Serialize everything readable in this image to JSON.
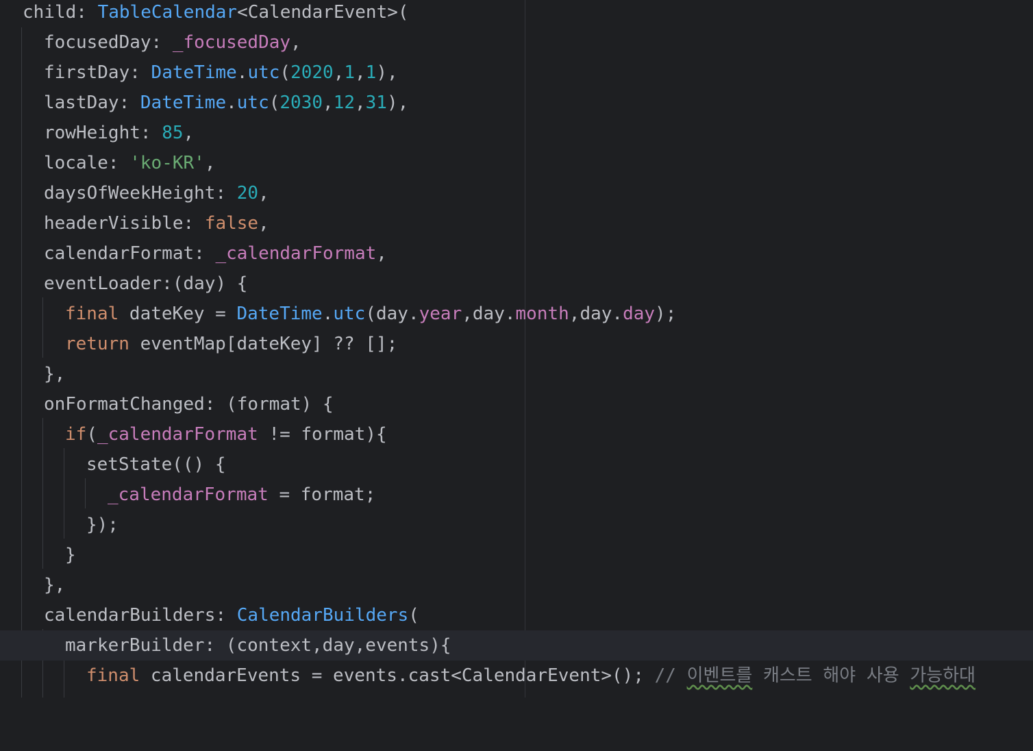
{
  "editor": {
    "lines": [
      [
        "child: ",
        "TableCalendar",
        "<CalendarEvent>("
      ],
      [
        "focusedDay: ",
        "_focusedDay",
        ","
      ],
      [
        "firstDay: ",
        "DateTime",
        ".",
        "utc",
        "(",
        "2020",
        ",",
        "1",
        ",",
        "1",
        "),"
      ],
      [
        "lastDay: ",
        "DateTime",
        ".",
        "utc",
        "(",
        "2030",
        ",",
        "12",
        ",",
        "31",
        "),"
      ],
      [
        "rowHeight: ",
        "85",
        ","
      ],
      [
        "locale: ",
        "'ko-KR'",
        ","
      ],
      [
        "daysOfWeekHeight: ",
        "20",
        ","
      ],
      [
        "headerVisible: ",
        "false",
        ","
      ],
      [
        "calendarFormat: ",
        "_calendarFormat",
        ","
      ],
      [
        "eventLoader:(day) {"
      ],
      [
        "final",
        " dateKey = ",
        "DateTime",
        ".",
        "utc",
        "(day.",
        "year",
        ",day.",
        "month",
        ",day.",
        "day",
        ");"
      ],
      [
        "return",
        " eventMap[dateKey] ?? [];"
      ],
      [
        "},"
      ],
      [
        "onFormatChanged: (format) {"
      ],
      [
        "if",
        "(",
        "_calendarFormat",
        " != format){"
      ],
      [
        "setState(() {"
      ],
      [
        "_calendarFormat",
        " = format;"
      ],
      [
        "});"
      ],
      [
        "}"
      ],
      [
        "},"
      ],
      [
        "calendarBuilders: ",
        "CalendarBuilders",
        "("
      ],
      [
        "markerBuilder: (context,day,events){"
      ],
      [
        "final",
        " calendarEvents = events.cast<CalendarEvent>(); ",
        "// ",
        "이벤트를",
        " 캐스트 해야 사용 ",
        "가능하대"
      ]
    ]
  }
}
